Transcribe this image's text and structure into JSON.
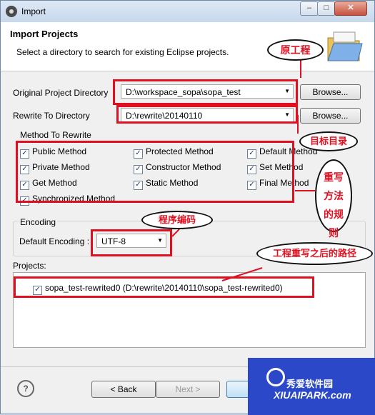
{
  "window": {
    "title": "Import",
    "min": "–",
    "max": "□",
    "close": "✕"
  },
  "header": {
    "title": "Import Projects",
    "subtitle": "Select a directory to search for existing Eclipse projects.",
    "icon": "folder-icon"
  },
  "original": {
    "label": "Original Project Directory",
    "value": "D:\\workspace_sopa\\sopa_test",
    "browse": "Browse..."
  },
  "rewrite": {
    "label": "Rewrite To Directory",
    "value": "D:\\rewrite\\20140110",
    "browse": "Browse..."
  },
  "methods": {
    "group_label": "Method To Rewrite",
    "items": [
      {
        "label": "Public Method",
        "checked": true
      },
      {
        "label": "Protected Method",
        "checked": true
      },
      {
        "label": "Default Method",
        "checked": true
      },
      {
        "label": "Private Method",
        "checked": true
      },
      {
        "label": "Constructor Method",
        "checked": true
      },
      {
        "label": "Set Method",
        "checked": true
      },
      {
        "label": "Get Method",
        "checked": true
      },
      {
        "label": "Static Method",
        "checked": true
      },
      {
        "label": "Final Method",
        "checked": true
      },
      {
        "label": "Synchronized Method",
        "checked": true
      }
    ]
  },
  "encoding": {
    "group_label": "Encoding",
    "label": "Default Encoding :",
    "value": "UTF-8"
  },
  "projects": {
    "label": "Projects:",
    "items": [
      {
        "label": "sopa_test-rewrited0 (D:\\rewrite\\20140110\\sopa_test-rewrited0)",
        "checked": true
      }
    ]
  },
  "footer": {
    "help": "?",
    "back": "< Back",
    "next": "Next >"
  },
  "annotations": {
    "original": "原工程",
    "target": "目标目录",
    "rules": "重写方法的规则",
    "encoding": "程序编码",
    "path": "工程重写之后的路径"
  },
  "watermark": {
    "line1": "秀爱软件园",
    "line2": "XIUAIPARK.com"
  },
  "colors": {
    "annotation": "#e01020",
    "watermark_bg": "#2a48c8"
  }
}
